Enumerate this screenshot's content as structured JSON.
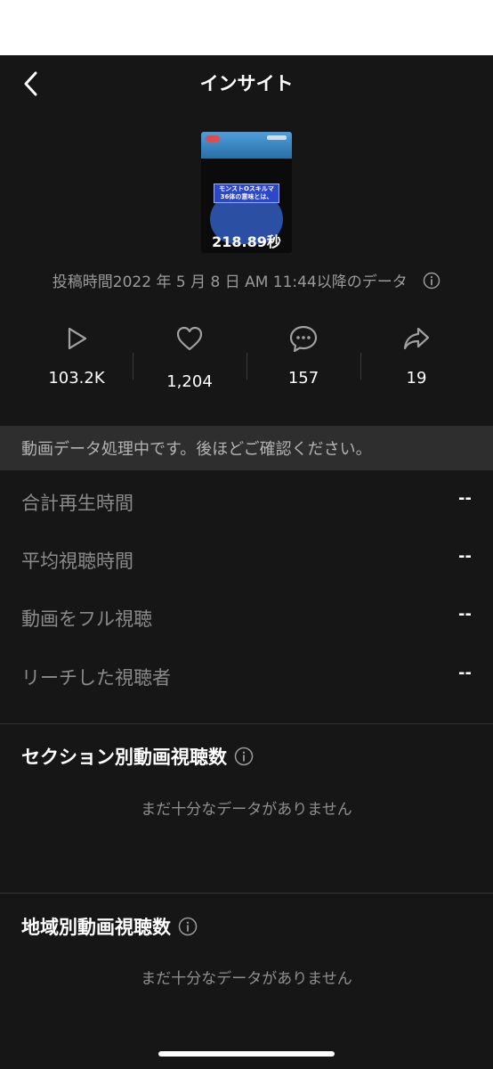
{
  "header": {
    "title": "インサイト"
  },
  "video": {
    "caption": "モンストOスキルマ\n36体の意味とは、",
    "duration": "218.89秒"
  },
  "posted": {
    "text": "投稿時間2022 年 5 月 8 日 AM 11:44以降のデータ"
  },
  "stats": [
    {
      "icon": "play-icon",
      "value": "103.2K"
    },
    {
      "icon": "heart-icon",
      "value": "1,204"
    },
    {
      "icon": "comment-icon",
      "value": "157"
    },
    {
      "icon": "share-icon",
      "value": "19"
    }
  ],
  "banner": {
    "text": "動画データ処理中です。後ほどご確認ください。"
  },
  "metrics": [
    {
      "label": "合計再生時間",
      "value": "--"
    },
    {
      "label": "平均視聴時間",
      "value": "--"
    },
    {
      "label": "動画をフル視聴",
      "value": "--"
    },
    {
      "label": "リーチした視聴者",
      "value": "--"
    }
  ],
  "sections": [
    {
      "title": "セクション別動画視聴数",
      "empty": "まだ十分なデータがありません"
    },
    {
      "title": "地域別動画視聴数",
      "empty": "まだ十分なデータがありません"
    }
  ]
}
